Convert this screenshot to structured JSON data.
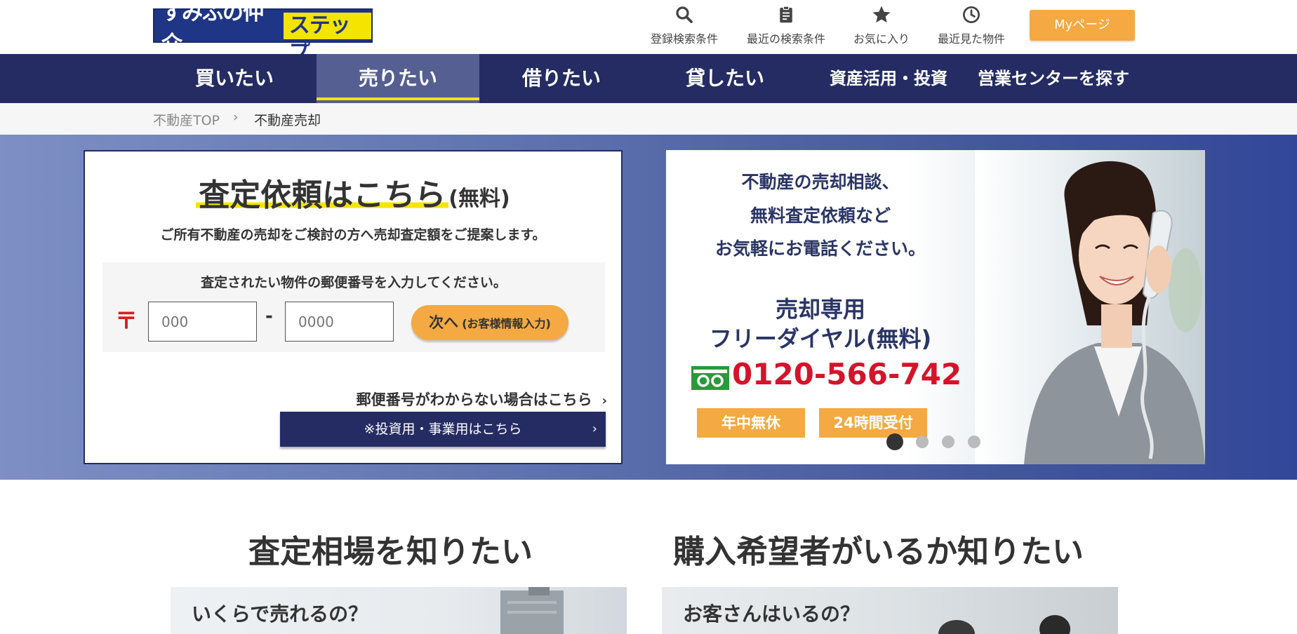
{
  "header": {
    "logo_text": "すみふの仲介",
    "logo_sub": "ステップ",
    "nav": [
      {
        "label": "登録検索条件",
        "icon": "search-icon"
      },
      {
        "label": "最近の検索条件",
        "icon": "clipboard-icon"
      },
      {
        "label": "お気に入り",
        "icon": "star-icon"
      },
      {
        "label": "最近見た物件",
        "icon": "clock-icon"
      }
    ],
    "mypage_label": "Myページ"
  },
  "main_nav": [
    {
      "label": "買いたい",
      "active": false
    },
    {
      "label": "売りたい",
      "active": true
    },
    {
      "label": "借りたい",
      "active": false
    },
    {
      "label": "貸したい",
      "active": false
    },
    {
      "label": "資産活用・投資",
      "active": false
    },
    {
      "label": "営業センターを探す",
      "active": false
    }
  ],
  "breadcrumb": {
    "home": "不動産TOP",
    "separator": "›",
    "current": "不動産売却"
  },
  "form_card": {
    "title": "査定依頼はこちら",
    "title_suffix": "(無料)",
    "subtitle": "ご所有不動産の売却をご検討の方へ売却査定額をご提案します。",
    "box_label": "査定されたい物件の郵便番号を入力してください。",
    "postal_mark": "〒",
    "zip1_placeholder": "000",
    "zip_dash": "-",
    "zip2_placeholder": "0000",
    "next_label": "次へ",
    "next_sub": "(お客様情報入力)",
    "unknown_link": "郵便番号がわからない場合はこちら",
    "invest_label": "※投資用・事業用はこちら",
    "chevron": "›"
  },
  "banner": {
    "line1": "不動産の売却相談、",
    "line2": "無料査定依頼など",
    "line3": "お気軽にお電話ください。",
    "big1": "売却専用",
    "big2": "フリーダイヤル(無料)",
    "phone": "0120-566-742",
    "tag1": "年中無休",
    "tag2": "24時間受付",
    "slide_count": 4,
    "active_slide": 1
  },
  "sections": {
    "left_title": "査定相場を知りたい",
    "right_title": "購入希望者がいるか知りたい",
    "left_card": "いくらで売れるの？",
    "right_card": "お客さんはいるの？"
  },
  "colors": {
    "navy": "#252c63",
    "orange": "#f4a942",
    "yellow": "#f5e400",
    "phone_red": "#d3142a"
  }
}
